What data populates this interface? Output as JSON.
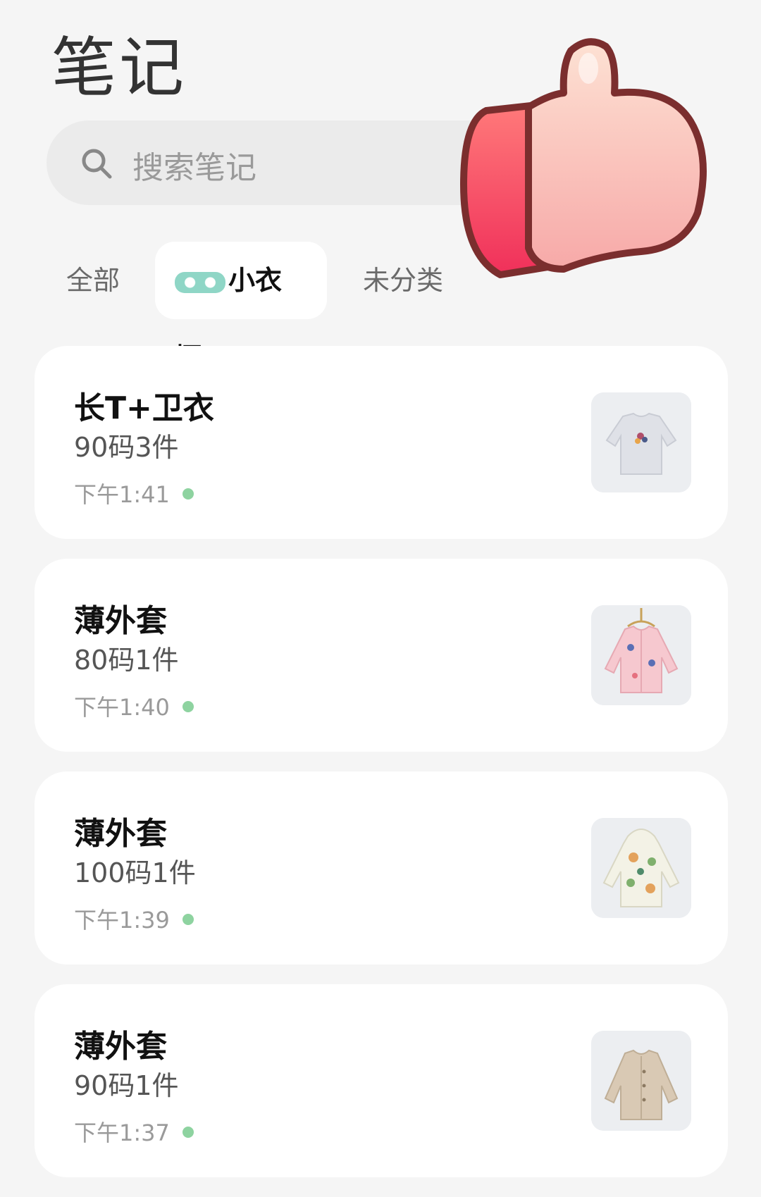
{
  "header": {
    "title": "笔记"
  },
  "search": {
    "placeholder": "搜索笔记",
    "icon": "search-icon"
  },
  "tabs": [
    {
      "label": "全部",
      "active": false
    },
    {
      "label": "小衣橱",
      "active": true
    },
    {
      "label": "未分类",
      "active": false
    }
  ],
  "notes": [
    {
      "title": "长T+卫衣",
      "subtitle": "90码3件",
      "time": "下午1:41",
      "thumb": "sweatshirt-image"
    },
    {
      "title": "薄外套",
      "subtitle": "80码1件",
      "time": "下午1:40",
      "thumb": "pink-jacket-image"
    },
    {
      "title": "薄外套",
      "subtitle": "100码1件",
      "time": "下午1:39",
      "thumb": "floral-jacket-image"
    },
    {
      "title": "薄外套",
      "subtitle": "90码1件",
      "time": "下午1:37",
      "thumb": "beige-jacket-image"
    }
  ],
  "colors": {
    "background": "#f5f5f5",
    "card": "#ffffff",
    "dot": "#8ed3a0"
  }
}
